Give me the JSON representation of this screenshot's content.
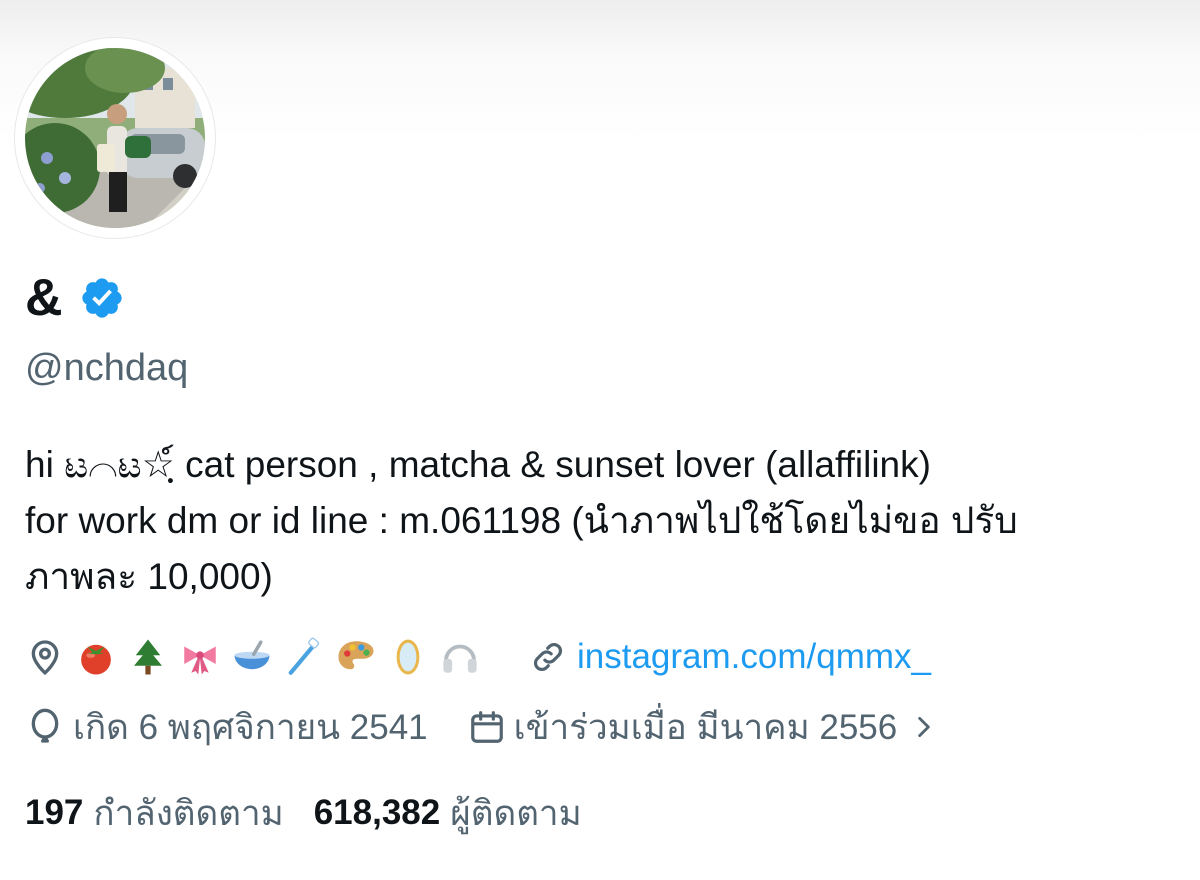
{
  "profile": {
    "display_name": "&",
    "handle": "@nchdaq",
    "verified": true,
    "verified_color": "#1d9bf0",
    "avatar_icon": "profile-photo-avatar",
    "bio_lines": [
      "hi ಟ⌒ಟ☆ฺ์ cat person , matcha & sunset lover (allaffilink)",
      "for work dm or id line : m.061198 (นำภาพไปใช้โดยไม่ขอ ปรับ",
      "ภาพละ 10,000)"
    ],
    "location_icon": "location-pin-icon",
    "location_emojis": [
      "tomato-icon",
      "evergreen-tree-icon",
      "ribbon-icon",
      "bowl-with-spoon-icon",
      "toothbrush-icon",
      "artist-palette-icon",
      "mirror-icon",
      "headphones-icon"
    ],
    "website_icon": "link-icon",
    "website": "instagram.com/qmmx_",
    "birth_icon": "balloon-icon",
    "birthdate": "เกิด 6 พฤศจิกายน 2541",
    "joined_icon": "calendar-icon",
    "joined": "เข้าร่วมเมื่อ มีนาคม 2556",
    "following_count": "197",
    "following_label": "กำลังติดตาม",
    "followers_count": "618,382",
    "followers_label": "ผู้ติดตาม"
  },
  "colors": {
    "text_primary": "#0f1419",
    "text_secondary": "#536471",
    "link": "#1d9bf0"
  }
}
